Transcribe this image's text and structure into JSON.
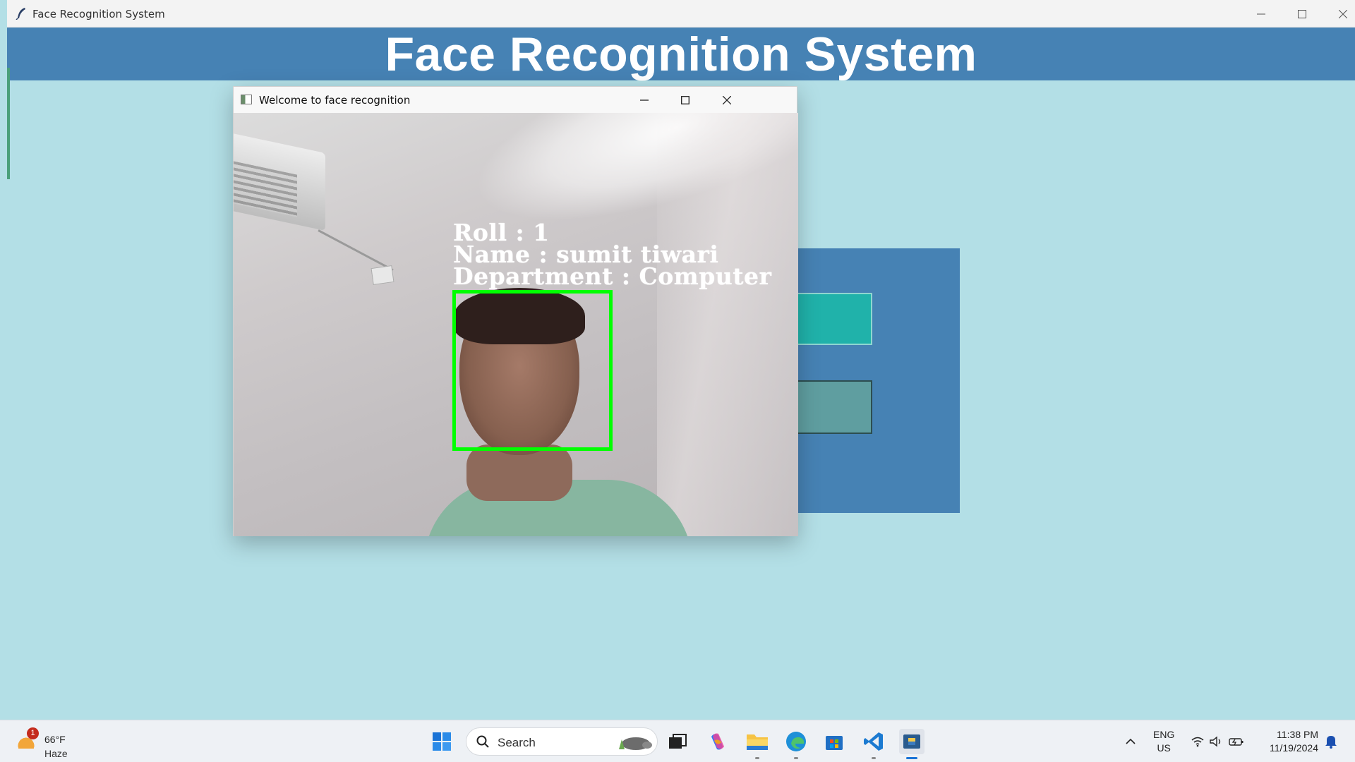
{
  "main_window": {
    "title": "Face Recognition System",
    "banner_title": "Face Recognition System",
    "colors": {
      "background": "#b3dfe6",
      "banner": "#4682b4",
      "panel": "#4682b4",
      "button_1": "#20b2aa",
      "button_2": "#5f9ea0"
    }
  },
  "cv_window": {
    "title": "Welcome to face recognition",
    "overlay": {
      "roll": "Roll : 1",
      "name": "Name : sumit tiwari",
      "department": "Department : Computer"
    },
    "face_box_color": "#00ff00"
  },
  "taskbar": {
    "weather": {
      "badge": "1",
      "temp": "66°F",
      "condition": "Haze"
    },
    "search_placeholder": "Search",
    "pinned_icons": [
      "windows-start-icon",
      "task-view-icon",
      "copilot-icon",
      "file-explorer-icon",
      "edge-icon",
      "microsoft-store-icon",
      "vscode-icon",
      "python-icon"
    ],
    "tray": {
      "lang_line1": "ENG",
      "lang_line2": "US",
      "time": "11:38 PM",
      "date": "11/19/2024"
    }
  }
}
